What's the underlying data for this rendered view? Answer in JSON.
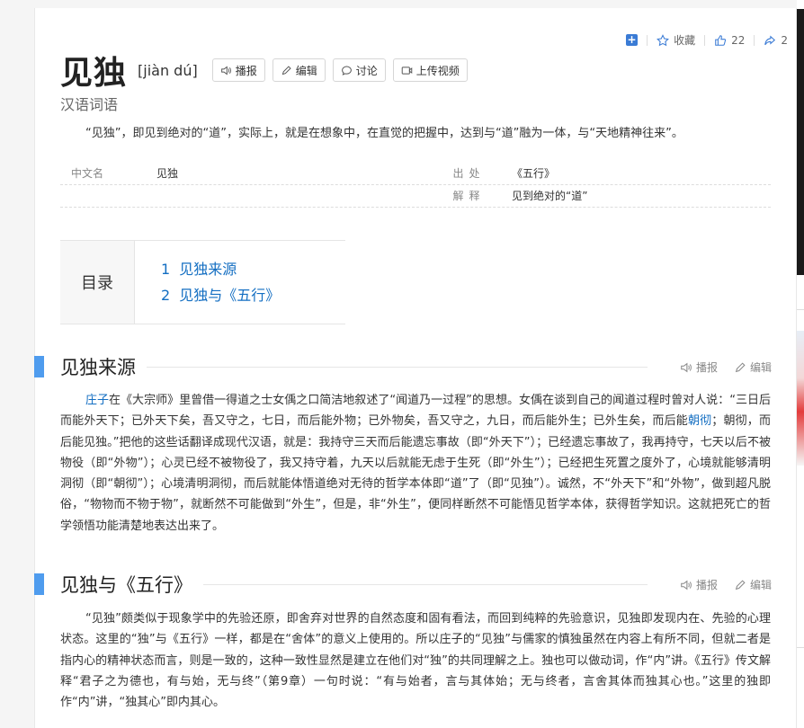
{
  "top_actions": {
    "collect_label": "收藏",
    "like_count": "22",
    "share_count": "2"
  },
  "entry": {
    "title": "见独",
    "pinyin": "[jiàn dú]",
    "buttons": {
      "play": "播报",
      "edit": "编辑",
      "discuss": "讨论",
      "upload_video": "上传视频"
    },
    "subtitle": "汉语词语",
    "summary": "“见独”，即见到绝对的“道”，实际上，就是在想象中，在直觉的把握中，达到与“道”融为一体，与“天地精神往来”。"
  },
  "info_table": {
    "row1": {
      "k1": "中文名",
      "v1": "见独",
      "k2": "出处",
      "v2": "《五行》"
    },
    "row2": {
      "k2": "解释",
      "v2": "见到绝对的“道”"
    }
  },
  "toc": {
    "label": "目录",
    "items": [
      {
        "num": "1",
        "text": "见独来源"
      },
      {
        "num": "2",
        "text": "见独与《五行》"
      }
    ]
  },
  "section_ops": {
    "play": "播报",
    "edit": "编辑"
  },
  "sections": [
    {
      "heading": "见独来源",
      "para": {
        "link1": "庄子",
        "t1": "在《大宗师》里曾借一得道之士女偊之口简洁地叙述了“闻道乃一过程”的思想。女偊在谈到自己的闻道过程时曾对人说：“三日后而能外天下；已外天下矣，吾又守之，七日，而后能外物；已外物矣，吾又守之，九日，而后能外生；已外生矣，而后能",
        "link2": "朝彻",
        "t2": "；朝彻，而后能见独。”把他的这些话翻译成现代汉语，就是：我持守三天而后能遗忘事故（即“外天下”）；已经遗忘事故了，我再持守，七天以后不被物役（即“外物”）；心灵已经不被物役了，我又持守着，九天以后就能无虑于生死（即“外生”）；已经把生死置之度外了，心境就能够清明洞彻（即“朝彻”）；心境清明洞彻，而后就能体悟道绝对无待的哲学本体即“道”了（即“见独”）。诚然，不“外天下”和“外物”，做到超凡脱俗，“物物而不物于物”，就断然不可能做到“外生”，但是，非“外生”，便同样断然不可能悟见哲学本体，获得哲学知识。这就把死亡的哲学领悟功能清楚地表达出来了。"
      }
    },
    {
      "heading": "见独与《五行》",
      "para": {
        "t1": "“见独”颇类似于现象学中的先验还原，即舍弃对世界的自然态度和固有看法，而回到纯粹的先验意识，见独即发现内在、先验的心理状态。这里的“独”与《五行》一样，都是在“舍体”的意义上使用的。所以庄子的“见独”与儒家的慎独虽然在内容上有所不同，但就二者是指内心的精神状态而言，则是一致的，这种一致性显然是建立在他们对“独”的共同理解之上。独也可以做动词，作“内”讲。《五行》传文解释“君子之为德也，有与始，无与终”（第9章）一句时说：“有与始者，言与其体始；无与终者，言舍其体而独其心也。”这里的独即作“内”讲，“独其心”即内其心。"
      }
    }
  ]
}
